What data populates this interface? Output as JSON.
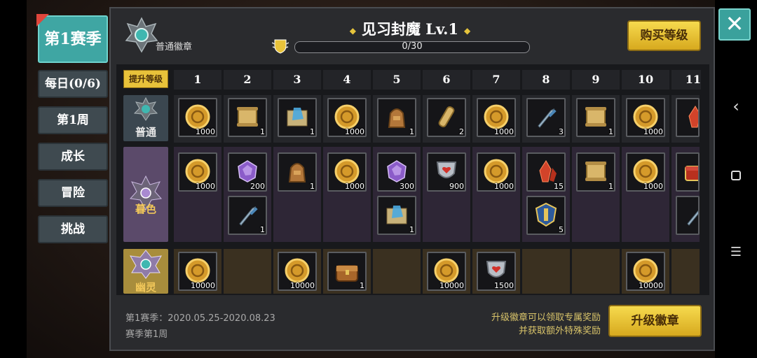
{
  "tabs": {
    "season": "第1赛季",
    "daily": "每日(0/6)",
    "week": "第1周",
    "growth": "成长",
    "adventure": "冒险",
    "challenge": "挑战"
  },
  "header": {
    "badge_label": "普通徽章",
    "title": "见习封魔  Lv.1",
    "progress_text": "0/30",
    "progress_fraction": 0.0,
    "buy_label": "购买等级",
    "close_glyph": "✕"
  },
  "grid": {
    "level_up_label": "提升等级",
    "columns": [
      "1",
      "2",
      "3",
      "4",
      "5",
      "6",
      "7",
      "8",
      "9",
      "10",
      "11"
    ],
    "rows": [
      {
        "label": "普通",
        "items": [
          {
            "col": 1,
            "icon": "gold-coin-icon",
            "qty": "1000"
          },
          {
            "col": 2,
            "icon": "scroll-icon",
            "qty": "1"
          },
          {
            "col": 3,
            "icon": "blue-map-icon",
            "qty": "1"
          },
          {
            "col": 4,
            "icon": "gold-coin-icon",
            "qty": "1000"
          },
          {
            "col": 5,
            "icon": "bag-icon",
            "qty": "1"
          },
          {
            "col": 6,
            "icon": "scroll-roll-icon",
            "qty": "2"
          },
          {
            "col": 7,
            "icon": "gold-coin-icon",
            "qty": "1000"
          },
          {
            "col": 8,
            "icon": "sword-icon",
            "qty": "3"
          },
          {
            "col": 9,
            "icon": "scroll-icon",
            "qty": "1"
          },
          {
            "col": 10,
            "icon": "gold-coin-icon",
            "qty": "1000"
          },
          {
            "col": 11,
            "icon": "red-crystal-icon",
            "qty": ""
          }
        ]
      },
      {
        "label": "暮色",
        "items": [
          {
            "col": 1,
            "icon": "gold-coin-icon",
            "qty": "1000"
          },
          {
            "col": 2,
            "icon": "purple-gem-icon",
            "qty": "200"
          },
          {
            "col": 3,
            "icon": "bag-icon",
            "qty": "1"
          },
          {
            "col": 4,
            "icon": "gold-coin-icon",
            "qty": "1000"
          },
          {
            "col": 5,
            "icon": "purple-gem-icon",
            "qty": "300"
          },
          {
            "col": 6,
            "icon": "heart-shield-icon",
            "qty": "900"
          },
          {
            "col": 7,
            "icon": "gold-coin-icon",
            "qty": "1000"
          },
          {
            "col": 8,
            "icon": "red-crystal-icon",
            "qty": "15"
          },
          {
            "col": 9,
            "icon": "scroll-icon",
            "qty": "1"
          },
          {
            "col": 10,
            "icon": "gold-coin-icon",
            "qty": "1000"
          },
          {
            "col": 11,
            "icon": "red-chest-icon",
            "qty": ""
          },
          {
            "col": 2,
            "icon": "sword-icon",
            "qty": "1",
            "sub": true
          },
          {
            "col": 5,
            "icon": "blue-map-icon",
            "qty": "1",
            "sub": true
          },
          {
            "col": 8,
            "icon": "blue-emblem-icon",
            "qty": "5",
            "sub": true
          },
          {
            "col": 11,
            "icon": "sword-icon",
            "qty": "",
            "sub": true
          }
        ]
      },
      {
        "label": "幽灵",
        "items": [
          {
            "col": 1,
            "icon": "gold-coin-icon",
            "qty": "10000"
          },
          {
            "col": 3,
            "icon": "gold-coin-icon",
            "qty": "10000"
          },
          {
            "col": 4,
            "icon": "leather-bag-icon",
            "qty": "1"
          },
          {
            "col": 6,
            "icon": "gold-coin-icon",
            "qty": "10000"
          },
          {
            "col": 7,
            "icon": "heart-shield-icon",
            "qty": "1500"
          },
          {
            "col": 10,
            "icon": "gold-coin-icon",
            "qty": "10000"
          }
        ]
      }
    ]
  },
  "footer": {
    "season_dates": "第1赛季：2020.05.25-2020.08.23",
    "season_week": "赛季第1周",
    "hint_line1": "升级徽章可以领取专属奖励",
    "hint_line2": "并获取额外特殊奖励",
    "upgrade_label": "升级徽章"
  },
  "colors": {
    "teal": "#3fa6a3",
    "gold": "#e8c23a",
    "purple_row": "#4a3d57",
    "gold_row": "#5c4a22"
  }
}
